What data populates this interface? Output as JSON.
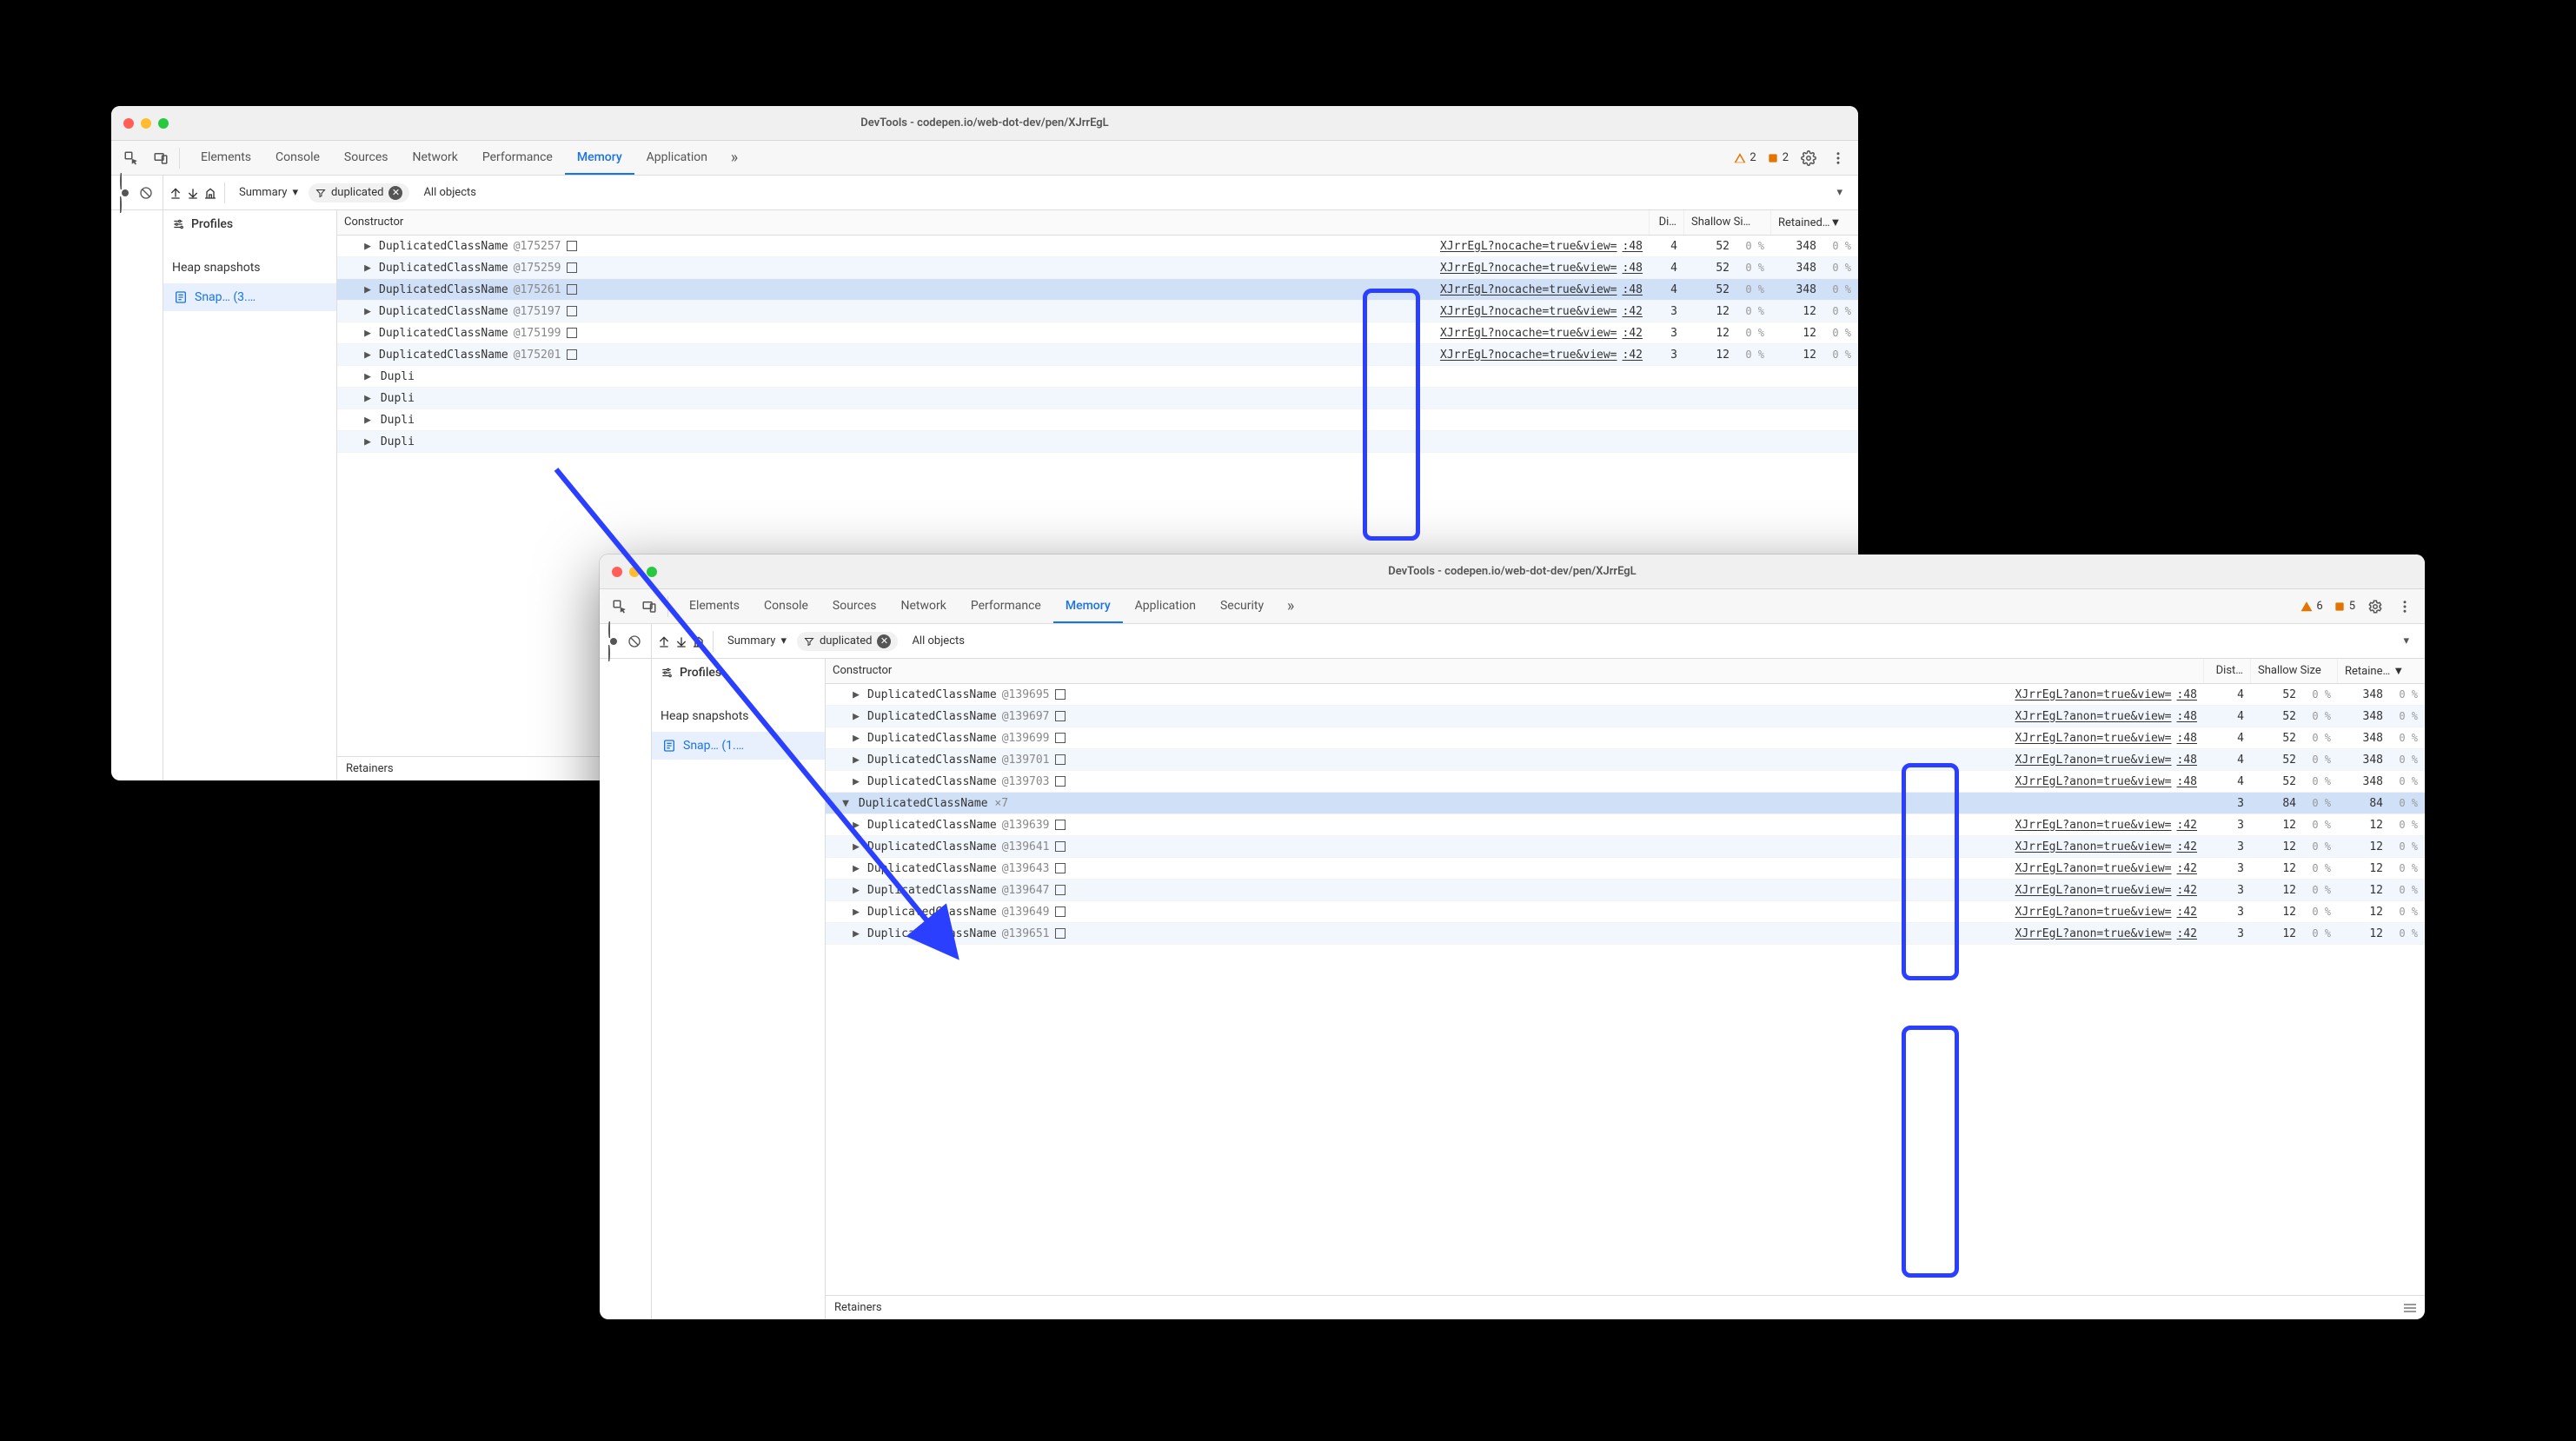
{
  "windows": {
    "a": {
      "title": "DevTools - codepen.io/web-dot-dev/pen/XJrrEgL",
      "tabs": [
        "Elements",
        "Console",
        "Sources",
        "Network",
        "Performance",
        "Memory",
        "Application"
      ],
      "active_tab": "Memory",
      "overflow": "»",
      "warn_count": "2",
      "issue_count": "2",
      "sidebar": {
        "profiles_label": "Profiles",
        "section": "Heap snapshots",
        "item": "Snap…  (3.…"
      },
      "sub": {
        "summary": "Summary",
        "filter": "duplicated",
        "objects": "All objects"
      },
      "columns": {
        "ctor": "Constructor",
        "dist": "Di…",
        "shallow": "Shallow Si…",
        "retained": "Retained…▼"
      },
      "rows": [
        {
          "name": "DuplicatedClassName",
          "id": "@175257",
          "link": "XJrrEgL?nocache=true&view=",
          "suffix": ":48",
          "dist": "4",
          "ss": "52",
          "ssp": "0 %",
          "rs": "348",
          "rsp": "0 %",
          "alt": false
        },
        {
          "name": "DuplicatedClassName",
          "id": "@175259",
          "link": "XJrrEgL?nocache=true&view=",
          "suffix": ":48",
          "dist": "4",
          "ss": "52",
          "ssp": "0 %",
          "rs": "348",
          "rsp": "0 %",
          "alt": true
        },
        {
          "name": "DuplicatedClassName",
          "id": "@175261",
          "link": "XJrrEgL?nocache=true&view=",
          "suffix": ":48",
          "dist": "4",
          "ss": "52",
          "ssp": "0 %",
          "rs": "348",
          "rsp": "0 %",
          "alt": false,
          "sel": true
        },
        {
          "name": "DuplicatedClassName",
          "id": "@175197",
          "link": "XJrrEgL?nocache=true&view=",
          "suffix": ":42",
          "dist": "3",
          "ss": "12",
          "ssp": "0 %",
          "rs": "12",
          "rsp": "0 %",
          "alt": true
        },
        {
          "name": "DuplicatedClassName",
          "id": "@175199",
          "link": "XJrrEgL?nocache=true&view=",
          "suffix": ":42",
          "dist": "3",
          "ss": "12",
          "ssp": "0 %",
          "rs": "12",
          "rsp": "0 %",
          "alt": false
        },
        {
          "name": "DuplicatedClassName",
          "id": "@175201",
          "link": "XJrrEgL?nocache=true&view=",
          "suffix": ":42",
          "dist": "3",
          "ss": "12",
          "ssp": "0 %",
          "rs": "12",
          "rsp": "0 %",
          "alt": true
        },
        {
          "name": "Dupli",
          "id": "",
          "link": "",
          "suffix": "",
          "dist": "",
          "ss": "",
          "ssp": "",
          "rs": "",
          "rsp": "",
          "alt": false,
          "trunc": true
        },
        {
          "name": "Dupli",
          "id": "",
          "link": "",
          "suffix": "",
          "dist": "",
          "ss": "",
          "ssp": "",
          "rs": "",
          "rsp": "",
          "alt": true,
          "trunc": true
        },
        {
          "name": "Dupli",
          "id": "",
          "link": "",
          "suffix": "",
          "dist": "",
          "ss": "",
          "ssp": "",
          "rs": "",
          "rsp": "",
          "alt": false,
          "trunc": true
        },
        {
          "name": "Dupli",
          "id": "",
          "link": "",
          "suffix": "",
          "dist": "",
          "ss": "",
          "ssp": "",
          "rs": "",
          "rsp": "",
          "alt": true,
          "trunc": true
        }
      ],
      "footer": "Retainers"
    },
    "b": {
      "title": "DevTools - codepen.io/web-dot-dev/pen/XJrrEgL",
      "tabs": [
        "Elements",
        "Console",
        "Sources",
        "Network",
        "Performance",
        "Memory",
        "Application",
        "Security"
      ],
      "active_tab": "Memory",
      "overflow": "»",
      "warn_count": "6",
      "issue_count": "5",
      "sidebar": {
        "profiles_label": "Profiles",
        "section": "Heap snapshots",
        "item": "Snap…  (1.…"
      },
      "sub": {
        "summary": "Summary",
        "filter": "duplicated",
        "objects": "All objects"
      },
      "columns": {
        "ctor": "Constructor",
        "dist": "Dist…",
        "shallow": "Shallow Size",
        "retained": "Retaine… ▼"
      },
      "rows": [
        {
          "name": "DuplicatedClassName",
          "id": "@139695",
          "link": "XJrrEgL?anon=true&view=",
          "suffix": ":48",
          "dist": "4",
          "ss": "52",
          "ssp": "0 %",
          "rs": "348",
          "rsp": "0 %",
          "alt": false
        },
        {
          "name": "DuplicatedClassName",
          "id": "@139697",
          "link": "XJrrEgL?anon=true&view=",
          "suffix": ":48",
          "dist": "4",
          "ss": "52",
          "ssp": "0 %",
          "rs": "348",
          "rsp": "0 %",
          "alt": true
        },
        {
          "name": "DuplicatedClassName",
          "id": "@139699",
          "link": "XJrrEgL?anon=true&view=",
          "suffix": ":48",
          "dist": "4",
          "ss": "52",
          "ssp": "0 %",
          "rs": "348",
          "rsp": "0 %",
          "alt": false
        },
        {
          "name": "DuplicatedClassName",
          "id": "@139701",
          "link": "XJrrEgL?anon=true&view=",
          "suffix": ":48",
          "dist": "4",
          "ss": "52",
          "ssp": "0 %",
          "rs": "348",
          "rsp": "0 %",
          "alt": true
        },
        {
          "name": "DuplicatedClassName",
          "id": "@139703",
          "link": "XJrrEgL?anon=true&view=",
          "suffix": ":48",
          "dist": "4",
          "ss": "52",
          "ssp": "0 %",
          "rs": "348",
          "rsp": "0 %",
          "alt": false
        },
        {
          "group": true,
          "name": "DuplicatedClassName",
          "mult": "×7",
          "dist": "3",
          "ss": "84",
          "ssp": "0 %",
          "rs": "84",
          "rsp": "0 %"
        },
        {
          "name": "DuplicatedClassName",
          "id": "@139639",
          "link": "XJrrEgL?anon=true&view=",
          "suffix": ":42",
          "dist": "3",
          "ss": "12",
          "ssp": "0 %",
          "rs": "12",
          "rsp": "0 %",
          "alt": false
        },
        {
          "name": "DuplicatedClassName",
          "id": "@139641",
          "link": "XJrrEgL?anon=true&view=",
          "suffix": ":42",
          "dist": "3",
          "ss": "12",
          "ssp": "0 %",
          "rs": "12",
          "rsp": "0 %",
          "alt": true
        },
        {
          "name": "DuplicatedClassName",
          "id": "@139643",
          "link": "XJrrEgL?anon=true&view=",
          "suffix": ":42",
          "dist": "3",
          "ss": "12",
          "ssp": "0 %",
          "rs": "12",
          "rsp": "0 %",
          "alt": false
        },
        {
          "name": "DuplicatedClassName",
          "id": "@139647",
          "link": "XJrrEgL?anon=true&view=",
          "suffix": ":42",
          "dist": "3",
          "ss": "12",
          "ssp": "0 %",
          "rs": "12",
          "rsp": "0 %",
          "alt": true
        },
        {
          "name": "DuplicatedClassName",
          "id": "@139649",
          "link": "XJrrEgL?anon=true&view=",
          "suffix": ":42",
          "dist": "3",
          "ss": "12",
          "ssp": "0 %",
          "rs": "12",
          "rsp": "0 %",
          "alt": false
        },
        {
          "name": "DuplicatedClassName",
          "id": "@139651",
          "link": "XJrrEgL?anon=true&view=",
          "suffix": ":42",
          "dist": "3",
          "ss": "12",
          "ssp": "0 %",
          "rs": "12",
          "rsp": "0 %",
          "alt": true
        }
      ],
      "footer": "Retainers"
    }
  },
  "colwidths": {
    "a": {
      "ctor": 560,
      "dist": 40,
      "ss": 60,
      "ssp": 40,
      "rs": 60,
      "rsp": 40
    },
    "b": {
      "ctor": 580,
      "dist": 54,
      "ss": 60,
      "ssp": 40,
      "rs": 60,
      "rsp": 40
    }
  }
}
